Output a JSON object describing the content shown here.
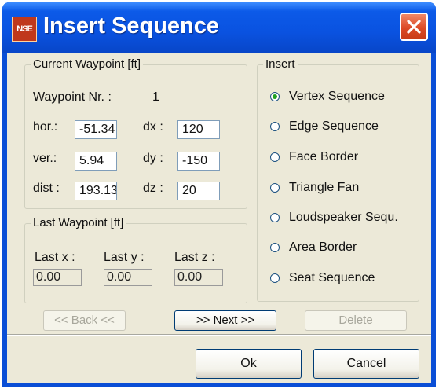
{
  "window": {
    "title": "Insert Sequence",
    "icon_text": "NSE",
    "icon": "app-icon",
    "close_icon": "close-icon"
  },
  "current_waypoint": {
    "legend": "Current Waypoint [ft]",
    "waypoint_label": "Waypoint Nr. :",
    "waypoint_value": "1",
    "hor_label": "hor.:",
    "hor_value": "-51.34",
    "ver_label": "ver.:",
    "ver_value": "5.94",
    "dist_label": "dist :",
    "dist_value": "193.13",
    "dx_label": "dx :",
    "dx_value": "120",
    "dy_label": "dy :",
    "dy_value": "-150",
    "dz_label": "dz :",
    "dz_value": "20"
  },
  "last_waypoint": {
    "legend": "Last Waypoint [ft]",
    "x_label": "Last x :",
    "y_label": "Last y :",
    "z_label": "Last z :",
    "x_value": "0.00",
    "y_value": "0.00",
    "z_value": "0.00"
  },
  "insert": {
    "legend": "Insert",
    "selected": "Vertex Sequence",
    "options": [
      "Vertex Sequence",
      "Edge Sequence",
      "Face Border",
      "Triangle Fan",
      "Loudspeaker Sequ.",
      "Area Border",
      "Seat Sequence"
    ]
  },
  "nav": {
    "back_label": "<< Back <<",
    "next_label": ">> Next >>",
    "delete_label": "Delete"
  },
  "footer": {
    "ok_label": "Ok",
    "cancel_label": "Cancel"
  },
  "colors": {
    "titlebar": "#0a52e0",
    "client_bg": "#ece9d8",
    "close_button": "#dc4a26",
    "radio_dot": "#21a121"
  }
}
